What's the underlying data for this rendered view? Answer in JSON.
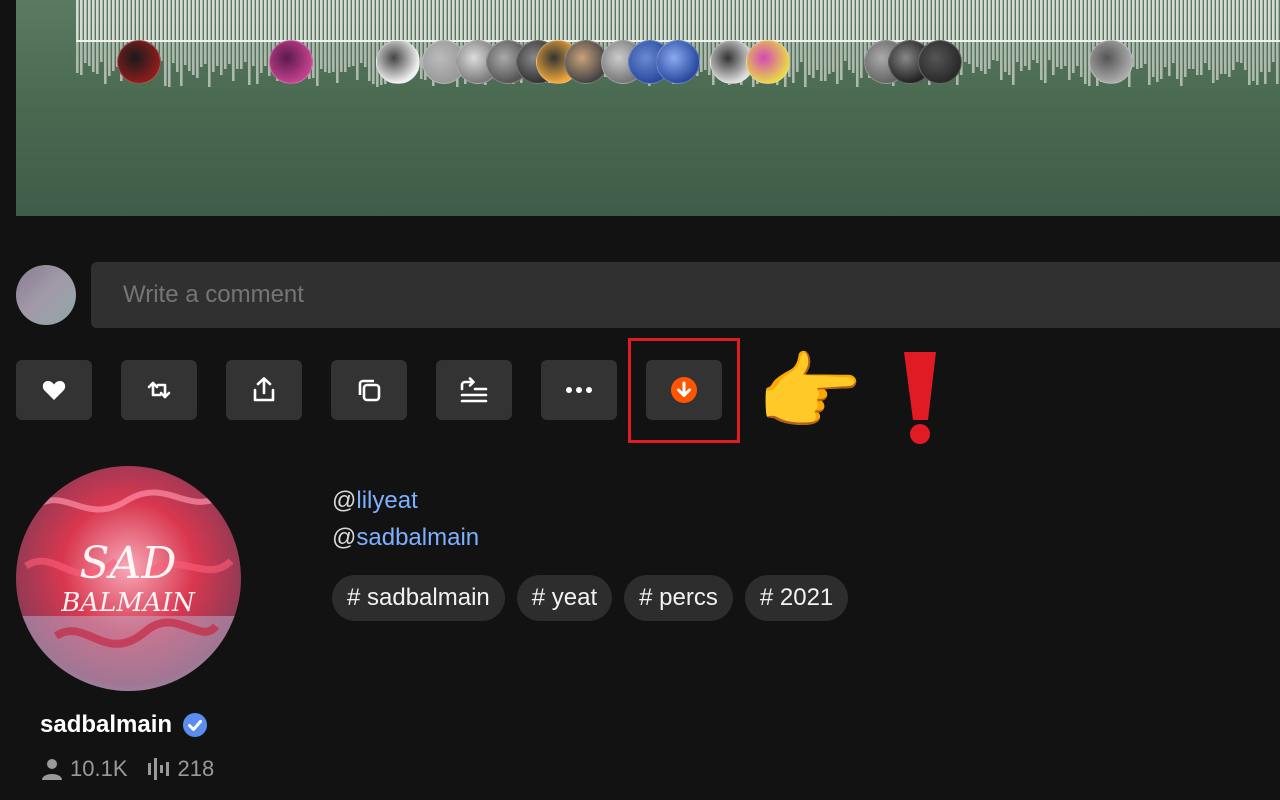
{
  "comment": {
    "placeholder": "Write a comment"
  },
  "actions": [
    {
      "name": "like-button",
      "icon": "heart-icon"
    },
    {
      "name": "repost-button",
      "icon": "repost-icon"
    },
    {
      "name": "share-button",
      "icon": "share-icon"
    },
    {
      "name": "copy-link-button",
      "icon": "copy-icon"
    },
    {
      "name": "add-to-next-up-button",
      "icon": "playlist-add-icon"
    },
    {
      "name": "more-button",
      "icon": "more-icon"
    },
    {
      "name": "download-button",
      "icon": "download-icon"
    }
  ],
  "colors": {
    "accent": "#ff5500",
    "highlight": "#e01b24",
    "link": "#7fb0ff"
  },
  "mentions": [
    {
      "prefix": "@",
      "handle": "lilyeat"
    },
    {
      "prefix": "@",
      "handle": "sadbalmain"
    }
  ],
  "tags": [
    "# sadbalmain",
    "# yeat",
    "# percs",
    "# 2021"
  ],
  "artist": {
    "name": "sadbalmain",
    "verified": true,
    "artwork_text": "SAD BALMAIN",
    "followers": "10.1K",
    "tracks": "218"
  }
}
